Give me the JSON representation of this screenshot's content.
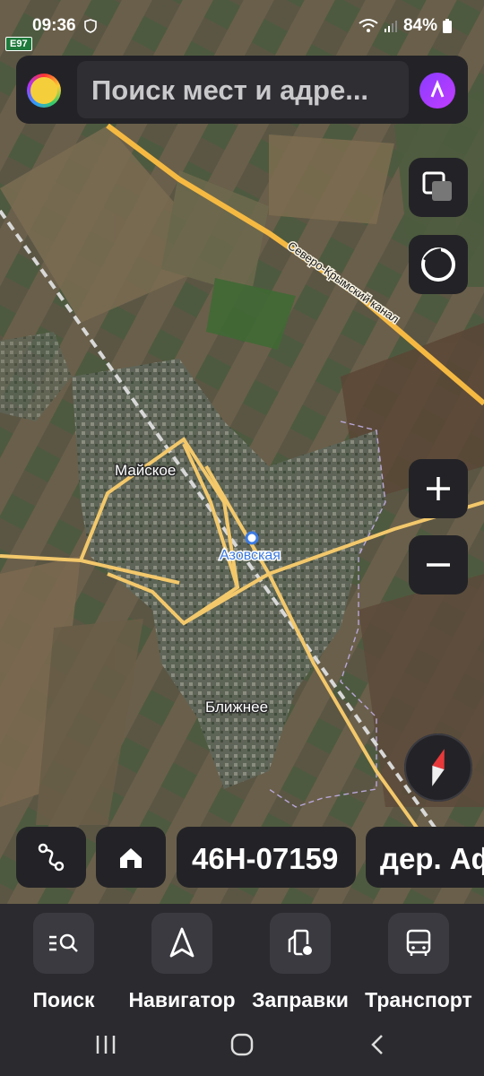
{
  "status_bar": {
    "time": "09:36",
    "battery": "84%"
  },
  "road_badge": "E97",
  "search": {
    "placeholder": "Поиск мест и адре..."
  },
  "map": {
    "labels": {
      "canal": "Северо-Крымский канал",
      "village_1": "Майское",
      "village_2": "Азовская",
      "village_3": "Ближнее"
    }
  },
  "route_chips": {
    "road_number": "46H-07159",
    "next_place": "дер. Аф"
  },
  "tabs": [
    {
      "label": "Поиск",
      "icon": "search-list-icon"
    },
    {
      "label": "Навигатор",
      "icon": "navigation-arrow-icon"
    },
    {
      "label": "Заправки",
      "icon": "fuel-station-icon"
    },
    {
      "label": "Транспорт",
      "icon": "bus-icon"
    }
  ],
  "colors": {
    "road": "#f3c86b",
    "major_road": "#f5b942",
    "panel": "#232327",
    "accent": "#3d7ae0",
    "compass_red": "#e8393a"
  }
}
